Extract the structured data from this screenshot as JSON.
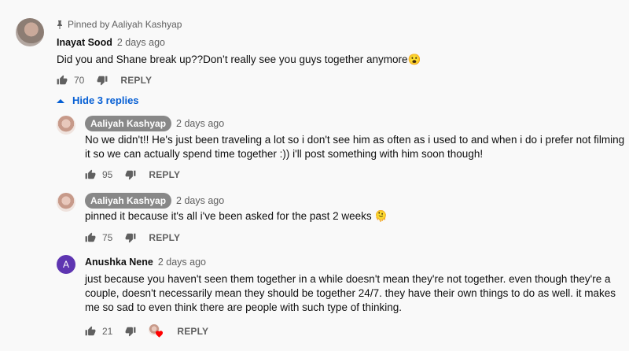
{
  "top_comment": {
    "pinned_label": "Pinned by Aaliyah Kashyap",
    "author": "Inayat Sood",
    "time": "2 days ago",
    "text": "Did you and Shane break up??Don’t really see you guys together anymore😮",
    "likes": "70",
    "reply_label": "REPLY"
  },
  "replies_toggle": {
    "label": "Hide 3 replies"
  },
  "replies": [
    {
      "author": "Aaliyah Kashyap",
      "time": "2 days ago",
      "text_line1": "No we didn't!! He's just been traveling a lot so i don't see him as often as i used to and when i do i prefer not filming",
      "text_line2": "it so we can actually spend time together :)) i'll post something with him soon though!",
      "likes": "95",
      "reply_label": "REPLY"
    },
    {
      "author": "Aaliyah Kashyap",
      "time": "2 days ago",
      "text_line1": "pinned it because it's all i've been asked for the past 2 weeks 🫠",
      "likes": "75",
      "reply_label": "REPLY"
    },
    {
      "avatar_letter": "A",
      "author": "Anushka Nene",
      "time": "2 days ago",
      "text_line1": "just because you haven't seen them together in a while doesn't mean they're not together. even though they're a",
      "text_line2": "couple, doesn't necessarily mean they should be together 24/7. they have their own things to do as well. it makes",
      "text_line3": "me so sad to even think there are people with such type of thinking.",
      "likes": "21",
      "reply_label": "REPLY"
    }
  ],
  "colors": {
    "background": "#f9f9f9",
    "link_blue": "#065fd4",
    "creator_chip": "#888888",
    "avatar_purple": "#5e35b1",
    "heart_red": "#ff0000"
  },
  "icons": [
    "pin-icon",
    "thumbs-up-icon",
    "thumbs-down-icon",
    "chevron-up-icon",
    "creator-heart-icon"
  ]
}
